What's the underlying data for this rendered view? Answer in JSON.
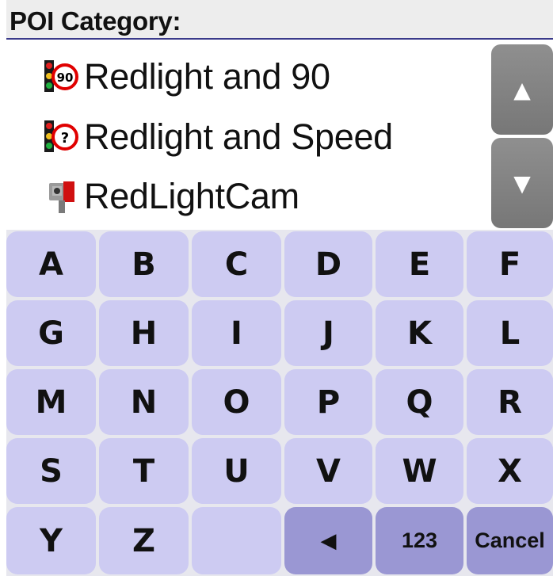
{
  "header": {
    "title": "POI Category:"
  },
  "list": {
    "items": [
      {
        "label": "Redlight and 90",
        "icon": "redlight-speed-90-icon",
        "sign_text": "90"
      },
      {
        "label": "Redlight and Speed",
        "icon": "redlight-speed-unknown-icon",
        "sign_text": "?"
      },
      {
        "label": "RedLightCam",
        "icon": "red-light-camera-icon"
      }
    ],
    "scroll_up": {
      "icon": "triangle-up-icon",
      "glyph": "▲"
    },
    "scroll_down": {
      "icon": "triangle-down-icon",
      "glyph": "▼"
    }
  },
  "keyboard": {
    "rows": [
      [
        "A",
        "B",
        "C",
        "D",
        "E",
        "F"
      ],
      [
        "G",
        "H",
        "I",
        "J",
        "K",
        "L"
      ],
      [
        "M",
        "N",
        "O",
        "P",
        "Q",
        "R"
      ],
      [
        "S",
        "T",
        "U",
        "V",
        "W",
        "X"
      ],
      [
        "Y",
        "Z"
      ]
    ],
    "backspace_glyph": "◀",
    "numbers_label": "123",
    "cancel_label": "Cancel"
  },
  "colors": {
    "key": "#cdcbf2",
    "key_function": "#9a97d3",
    "scroll_button": "#8a8a8a",
    "header_bg": "#ededed",
    "header_rule": "#3a3a8a"
  }
}
